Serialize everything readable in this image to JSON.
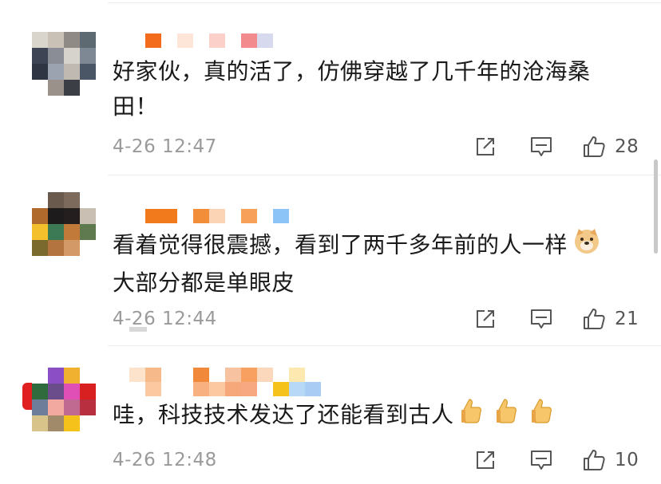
{
  "comments": [
    {
      "text": "好家伙，真的活了，仿佛穿越了几千年的沧海桑田！",
      "timestamp": "4-26 12:47",
      "likes": "28",
      "emojis": []
    },
    {
      "text": "看着觉得很震撼，看到了两千多年前的人一样",
      "text2": "大部分都是单眼皮",
      "timestamp": "4-26 12:44",
      "likes": "21",
      "emojis": [
        "doge-emoji"
      ]
    },
    {
      "text": "哇，科技技术发达了还能看到古人",
      "timestamp": "4-26 12:48",
      "likes": "10",
      "emojis": [
        "thumbs-up-emoji",
        "thumbs-up-emoji",
        "thumbs-up-emoji"
      ]
    }
  ],
  "icons": {
    "share": "share-icon",
    "reply": "comment-icon",
    "like": "thumbs-up-icon"
  },
  "colors": {
    "text": "#1a1a1a",
    "meta": "#9a9a9a",
    "icon": "#555555"
  }
}
